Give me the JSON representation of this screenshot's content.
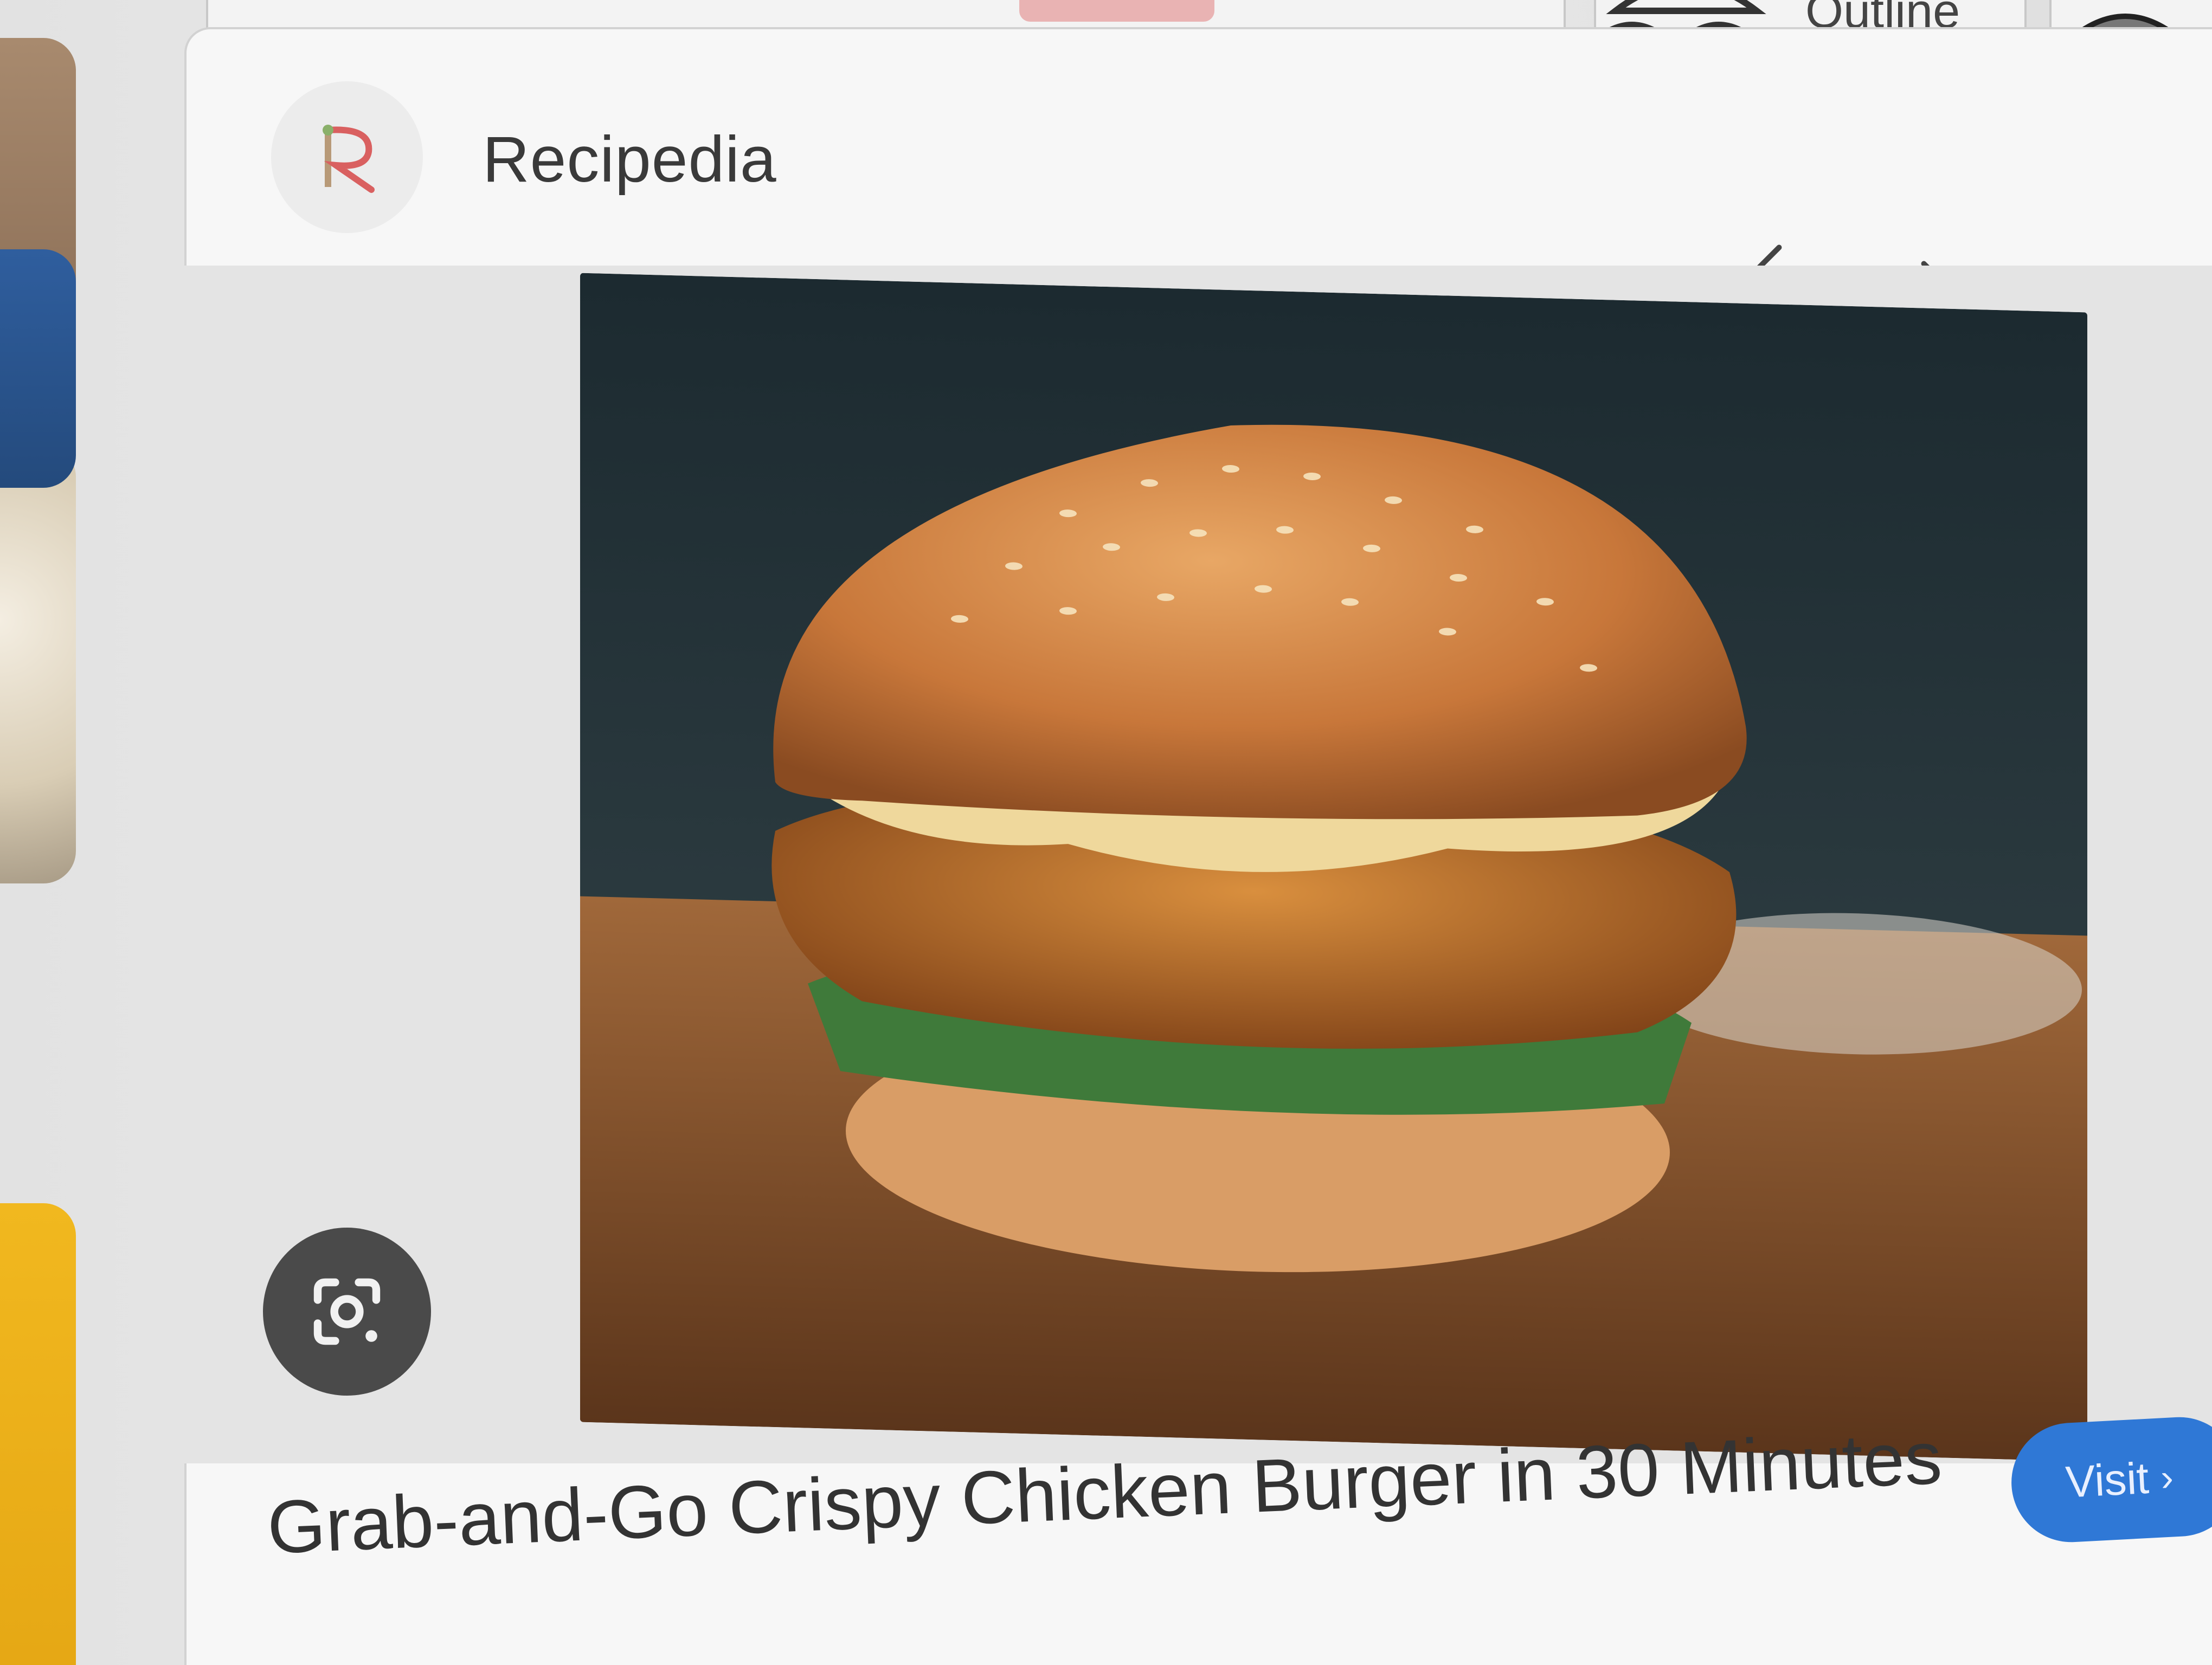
{
  "top_strip": {
    "chip_label": "Outline"
  },
  "result": {
    "source": {
      "name": "Recipedia",
      "logo_letter": "R"
    },
    "nav": {
      "prev_icon": "chevron-left-icon",
      "next_icon": "chevron-right-icon",
      "more_icon": "more-vert-icon"
    },
    "title": "Grab-and-Go Crispy Chicken Burger in 30 Minutes",
    "visit_label": "Visit",
    "visit_icon": "chevron-right-icon",
    "lens_icon": "google-lens-icon"
  },
  "colors": {
    "visit_button": "#2f78d6",
    "lens_button": "#4a4a4a",
    "logo_accent": "#d96060"
  }
}
